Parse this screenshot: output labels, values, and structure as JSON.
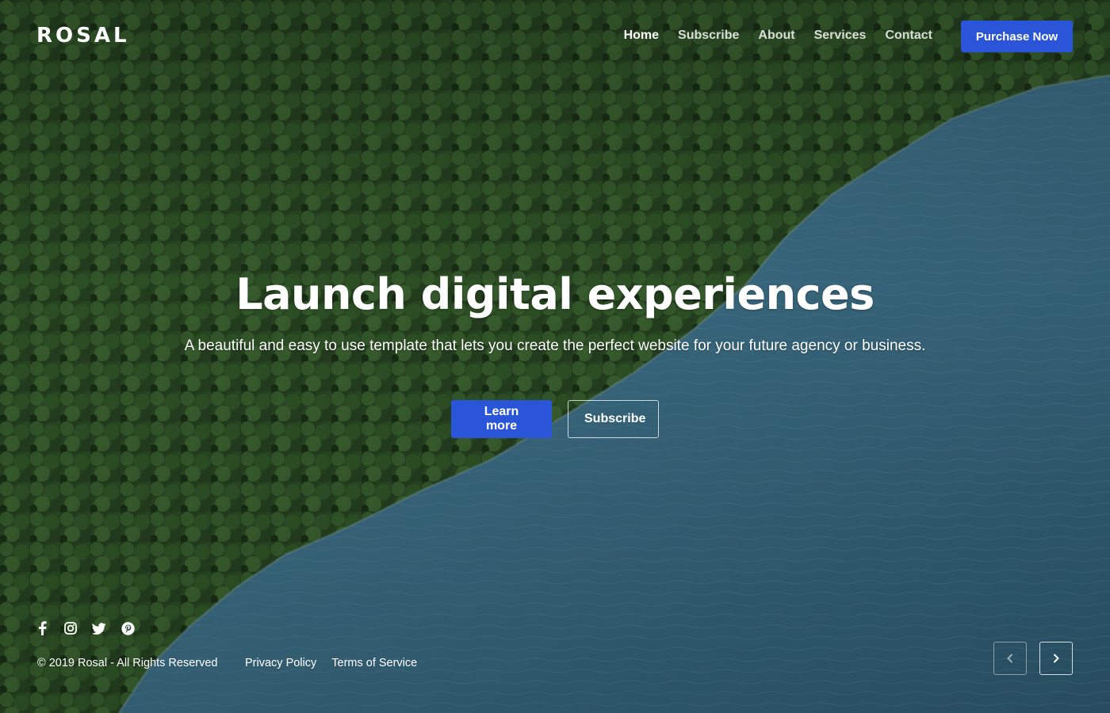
{
  "brand": {
    "logo": "ROSAL"
  },
  "nav": {
    "items": [
      {
        "label": "Home"
      },
      {
        "label": "Subscribe"
      },
      {
        "label": "About"
      },
      {
        "label": "Services"
      },
      {
        "label": "Contact"
      }
    ],
    "purchase_label": "Purchase Now"
  },
  "hero": {
    "headline": "Launch digital experiences",
    "subline": "A beautiful and easy to use template that lets you create the perfect website for your future agency or business.",
    "primary_label": "Learn more",
    "secondary_label": "Subscribe"
  },
  "footer": {
    "social_icons": [
      "facebook-icon",
      "instagram-icon",
      "twitter-icon",
      "pinterest-icon"
    ],
    "copyright": "© 2019 Rosal - All Rights Reserved",
    "links": [
      {
        "label": "Privacy Policy"
      },
      {
        "label": "Terms of Service"
      }
    ]
  },
  "slider": {
    "prev_icon": "chevron-left-icon",
    "next_icon": "chevron-right-icon"
  },
  "colors": {
    "accent": "#2b55d9",
    "forest": "#24401f",
    "water": "#3c6a80"
  }
}
